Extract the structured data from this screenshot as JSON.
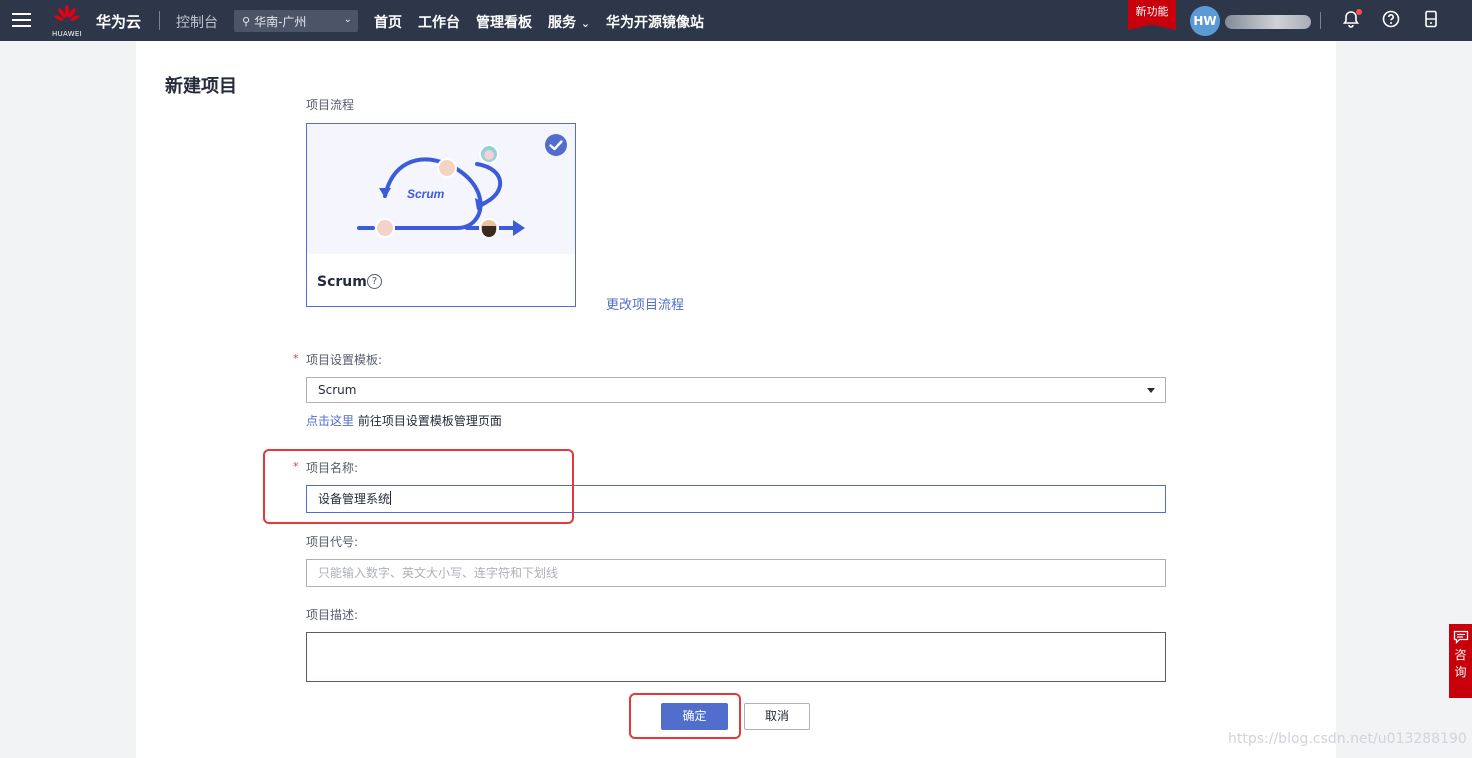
{
  "topbar": {
    "logo_text": "HUAWEI",
    "brand": "华为云",
    "console": "控制台",
    "region": "华南-广州",
    "nav": [
      "首页",
      "工作台",
      "管理看板",
      "服务",
      "华为开源镜像站"
    ],
    "new_feature": "新功能",
    "avatar": "HW"
  },
  "page": {
    "title": "新建项目",
    "process_label": "项目流程",
    "process_card": {
      "illustration_text": "Scrum",
      "name": "Scrum",
      "help": "?"
    },
    "change_process_link": "更改项目流程",
    "template_label": "项目设置模板:",
    "template_value": "Scrum",
    "template_link": "点击这里",
    "template_link_suffix": "前往项目设置模板管理页面",
    "name_label": "项目名称:",
    "name_value": "设备管理系统",
    "code_label": "项目代号:",
    "code_placeholder": "只能输入数字、英文大小写、连字符和下划线",
    "desc_label": "项目描述:",
    "confirm_button": "确定",
    "cancel_button": "取消",
    "required_mark": "*"
  },
  "consult": [
    "咨",
    "询"
  ],
  "watermark": "https://blog.csdn.net/u013288190",
  "colors": {
    "topbar_bg": "#2e3749",
    "primary": "#526ecc",
    "highlight": "#e4393c",
    "huawei_red": "#c7000b"
  }
}
